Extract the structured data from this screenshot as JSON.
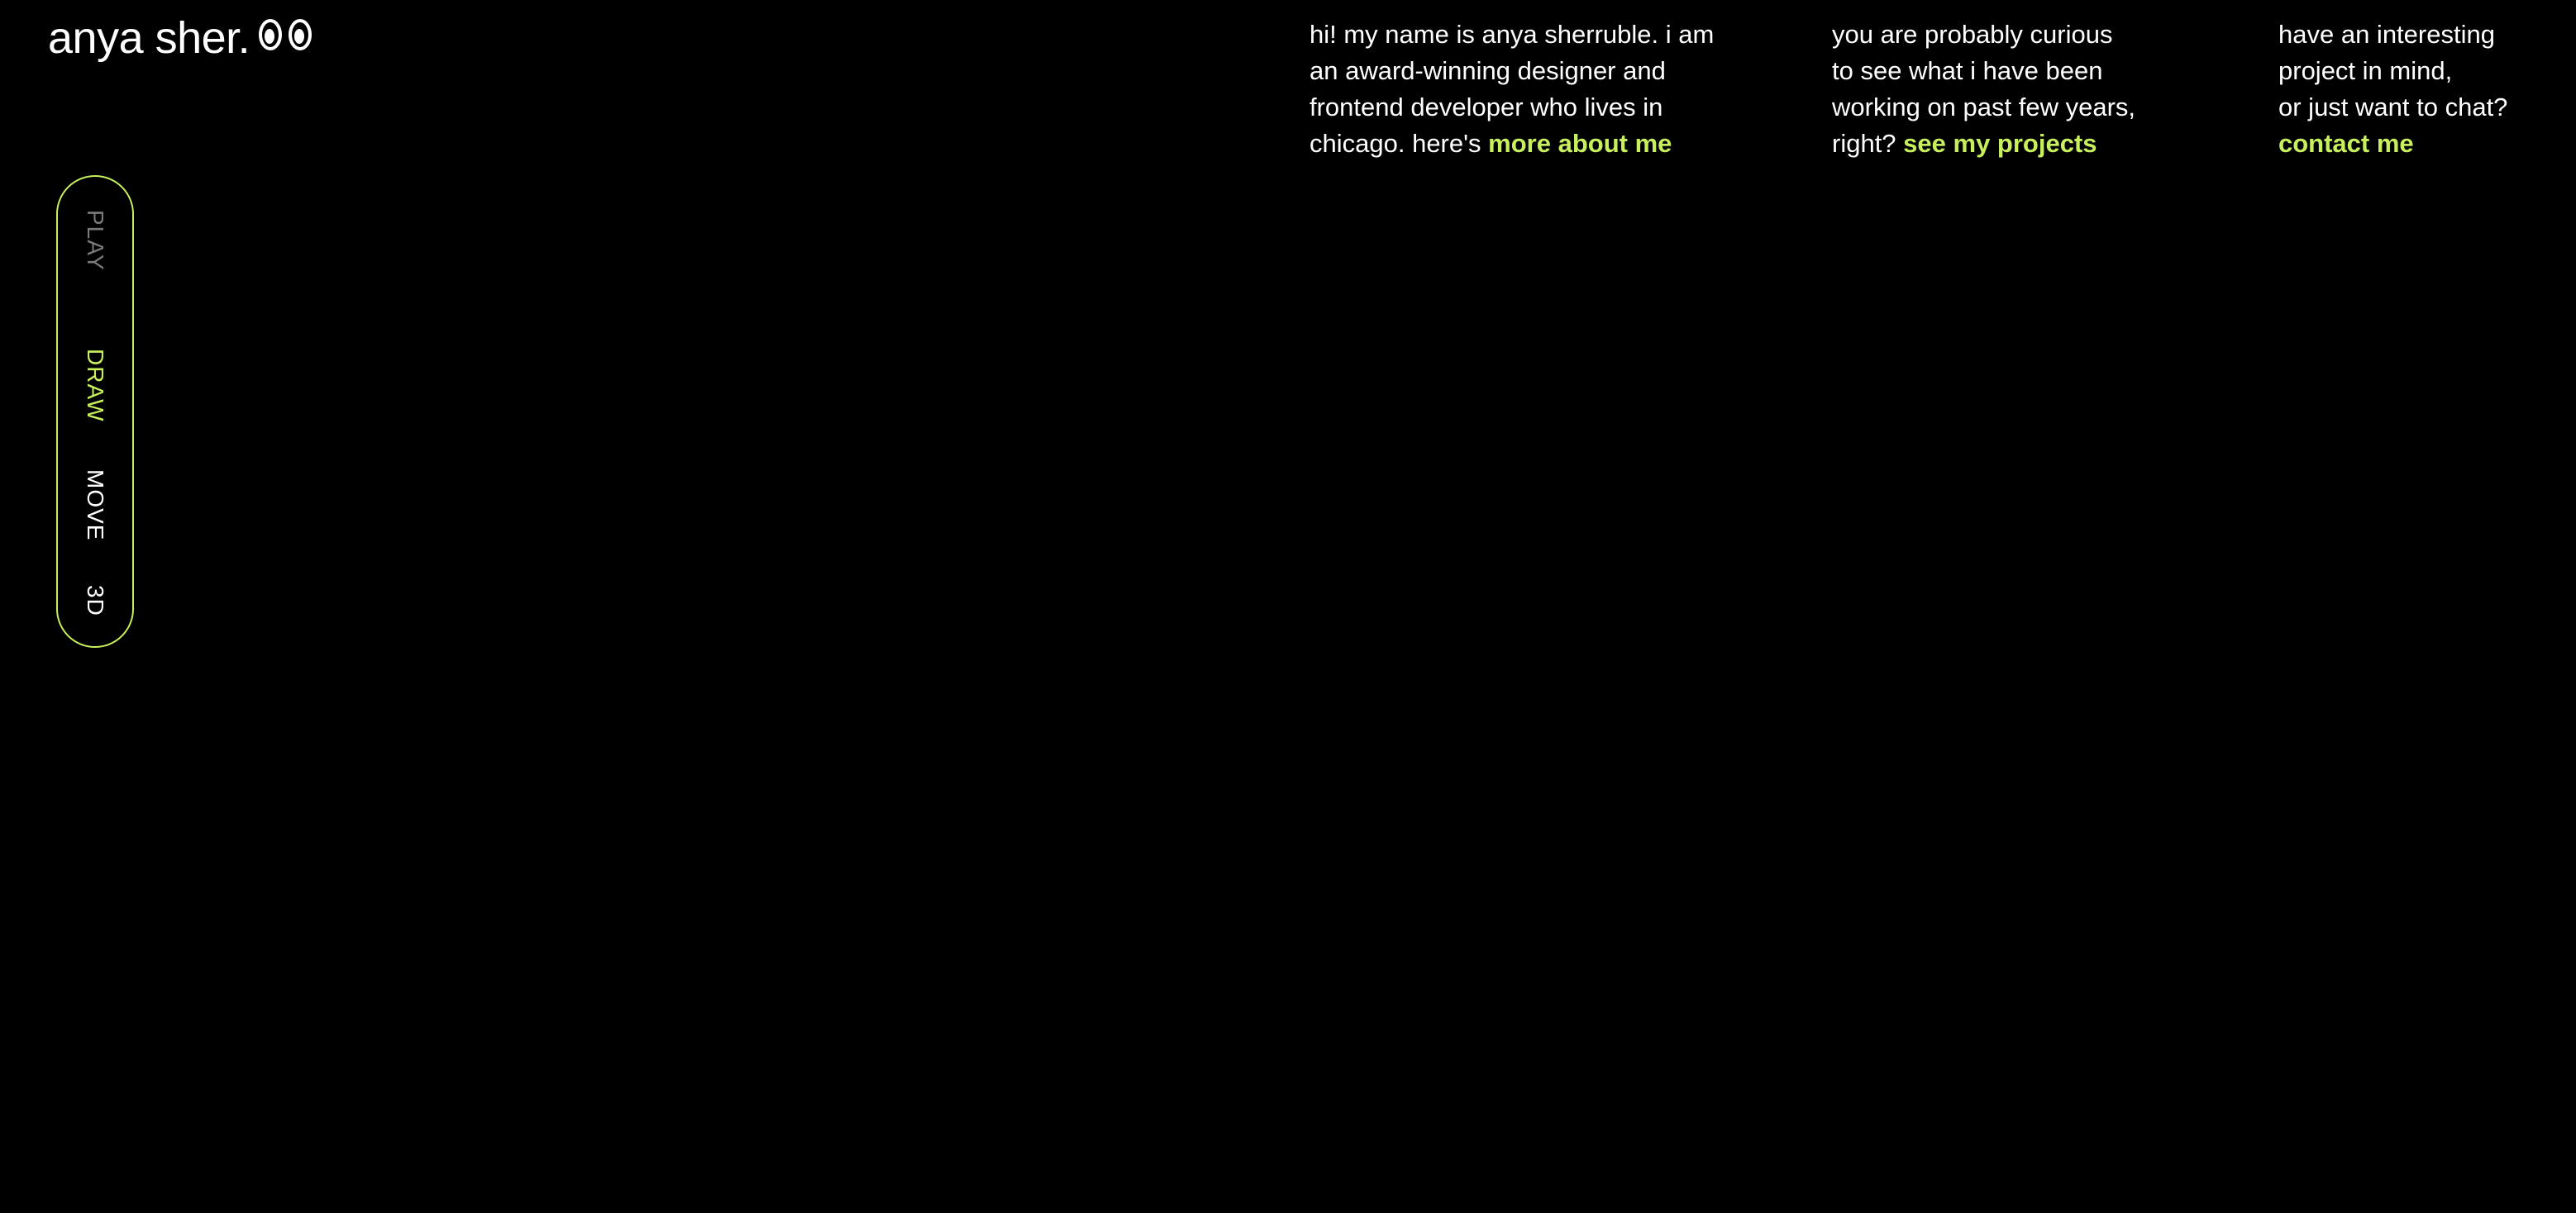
{
  "brand": {
    "name": "anya sher."
  },
  "colors": {
    "background": "#000000",
    "text": "#ffffff",
    "accent": "#c7f05c",
    "muted": "#7b7b7b"
  },
  "intro": {
    "about": {
      "lines": [
        "hi! my name is anya sherruble. i am",
        "an award-winning designer and",
        "frontend developer who lives in",
        "chicago. here's"
      ],
      "link": "more about me"
    },
    "projects": {
      "lines": [
        "you are probably curious",
        "to see what i have been",
        "working on past few years,",
        "right?"
      ],
      "link": "see my projects"
    },
    "contact": {
      "lines": [
        "have an interesting",
        "project in mind,",
        "or just want to chat?"
      ],
      "link": "contact me"
    }
  },
  "modes": {
    "items": [
      {
        "label": "PLAY",
        "state": "disabled"
      },
      {
        "label": "DRAW",
        "state": "active"
      },
      {
        "label": "MOVE",
        "state": "default"
      },
      {
        "label": "3D",
        "state": "default"
      }
    ]
  },
  "icons": {
    "logo_icon": "eyes-icon"
  }
}
